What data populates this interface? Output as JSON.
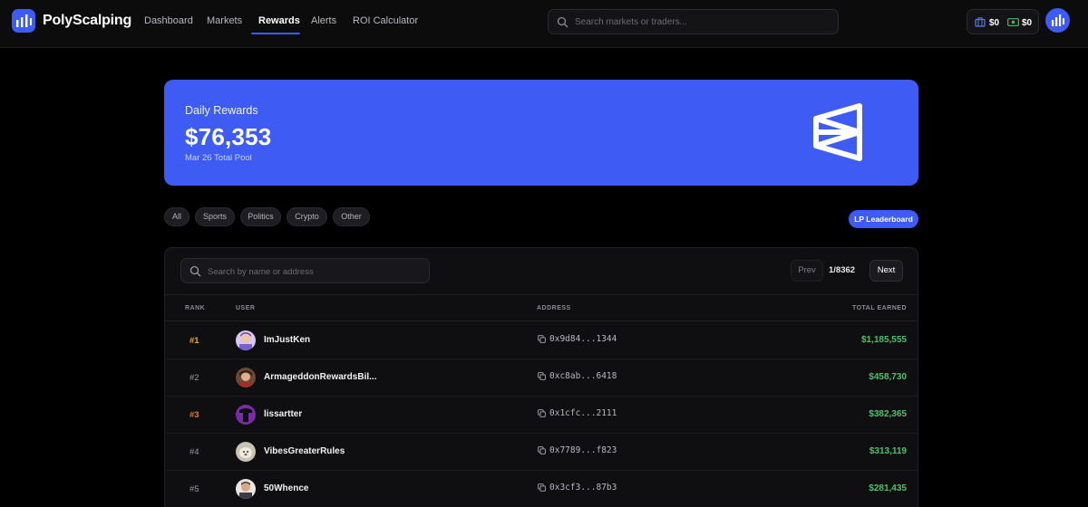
{
  "app": {
    "brand": "PolyScalping",
    "nav": [
      {
        "label": "Dashboard",
        "active": false
      },
      {
        "label": "Markets",
        "active": false
      },
      {
        "label": "Rewards",
        "active": true
      },
      {
        "label": "Alerts",
        "active": false
      },
      {
        "label": "ROI Calculator",
        "active": false
      }
    ],
    "search_placeholder": "Search markets or traders...",
    "wallet": {
      "portfolio_value": "$0",
      "cash_value": "$0"
    },
    "accent": "#3d5cf5"
  },
  "banner": {
    "label": "Daily Rewards",
    "amount": "$76,353",
    "sub": "Mar 26 Total Pool"
  },
  "filters": [
    "All",
    "Sports",
    "Politics",
    "Crypto",
    "Other"
  ],
  "lp_button": "LP Leaderboard",
  "table": {
    "search_placeholder": "Search by name or address",
    "prev": "Prev",
    "page": "1/8362",
    "next": "Next",
    "headers": {
      "rank": "RANK",
      "user": "USER",
      "address": "ADDRESS",
      "earned": "TOTAL EARNED"
    },
    "rows": [
      {
        "rank": "#1",
        "user": "ImJustKen",
        "address": "0x9d84...1344",
        "earned": "$1,185,555"
      },
      {
        "rank": "#2",
        "user": "ArmageddonRewardsBil...",
        "address": "0xc8ab...6418",
        "earned": "$458,730"
      },
      {
        "rank": "#3",
        "user": "lissartter",
        "address": "0x1cfc...2111",
        "earned": "$382,365"
      },
      {
        "rank": "#4",
        "user": "VibesGreaterRules",
        "address": "0x7789...f823",
        "earned": "$313,119"
      },
      {
        "rank": "#5",
        "user": "50Whence",
        "address": "0x3cf3...87b3",
        "earned": "$281,435"
      }
    ],
    "earned_color": "#46c46a"
  }
}
